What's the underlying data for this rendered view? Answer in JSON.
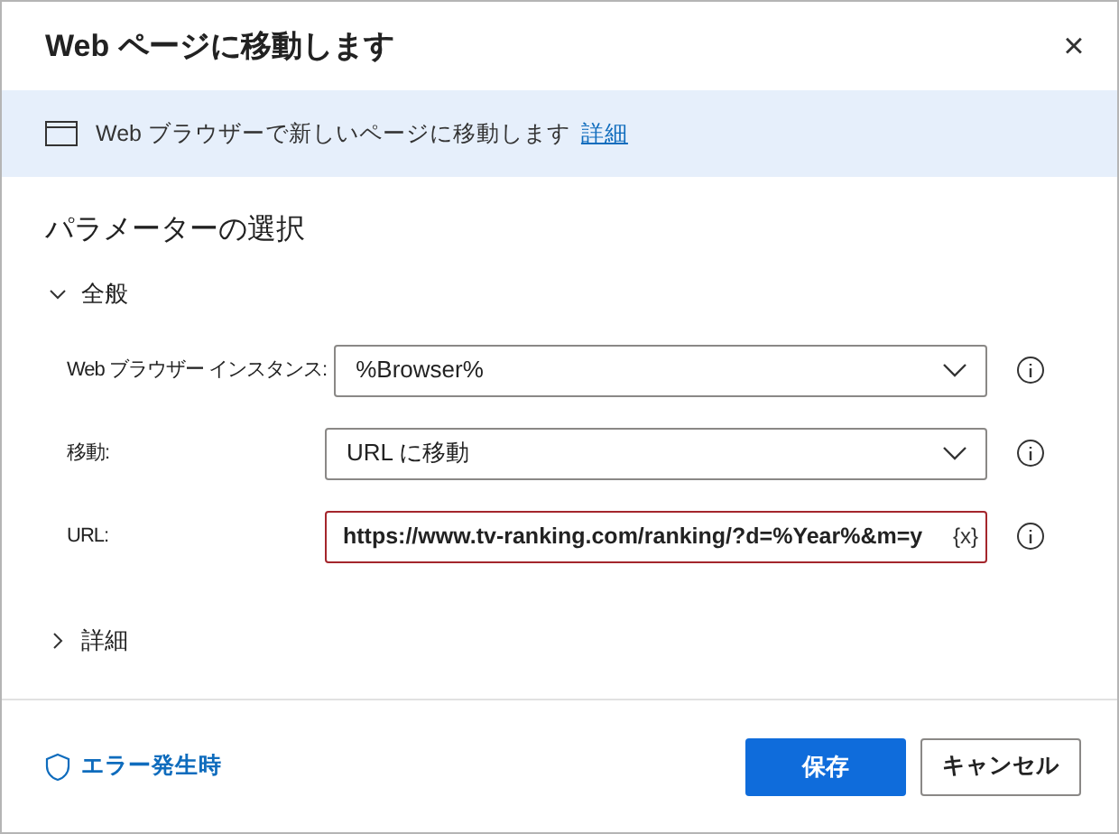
{
  "dialog": {
    "title": "Web ページに移動します",
    "close": "×"
  },
  "banner": {
    "text": "Web ブラウザーで新しいページに移動します",
    "link": "詳細"
  },
  "heading": "パラメーターの選択",
  "sections": [
    {
      "label": "全般",
      "expanded": true,
      "fields": [
        {
          "kind": "select",
          "label": "Web ブラウザー インスタンス:",
          "value": "%Browser%"
        },
        {
          "kind": "select",
          "label": "移動:",
          "value": "URL に移動"
        },
        {
          "kind": "text",
          "label": "URL:",
          "value": "https://www.tv-ranking.com/ranking/?d=%Year%&m=y",
          "variable_button": "{x}"
        }
      ]
    },
    {
      "label": "詳細",
      "expanded": false
    }
  ],
  "footer": {
    "error_link": "エラー発生時",
    "save": "保存",
    "cancel": "キャンセル"
  }
}
